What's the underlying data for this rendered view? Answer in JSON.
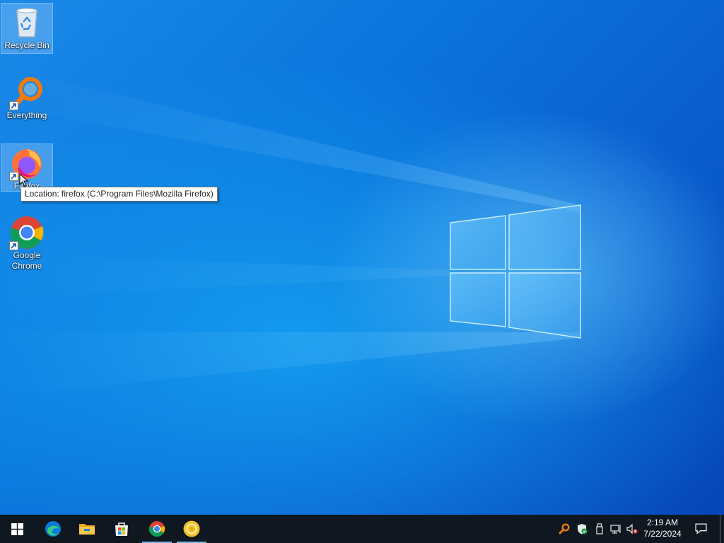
{
  "desktop": {
    "icons": [
      {
        "label": "Recycle Bin",
        "icon": "recycle-bin-icon"
      },
      {
        "label": "Everything",
        "icon": "everything-search-icon"
      },
      {
        "label": "Firefox",
        "icon": "firefox-icon"
      },
      {
        "label": "Google Chrome",
        "icon": "chrome-icon"
      }
    ]
  },
  "tooltip": {
    "text": "Location: firefox (C:\\Program Files\\Mozilla Firefox)"
  },
  "taskbar": {
    "start": {
      "icon": "windows-start-icon"
    },
    "pinned": [
      {
        "name": "Microsoft Edge",
        "icon": "edge-icon",
        "running": false
      },
      {
        "name": "File Explorer",
        "icon": "file-explorer-icon",
        "running": false
      },
      {
        "name": "Microsoft Store",
        "icon": "store-icon",
        "running": false
      },
      {
        "name": "Google Chrome",
        "icon": "chrome-icon",
        "running": true
      },
      {
        "name": "App",
        "icon": "yellow-app-icon",
        "running": true
      }
    ],
    "tray": {
      "icons": [
        "everything-tray-icon",
        "security-shield-icon",
        "usb-drive-icon",
        "network-icon",
        "volume-muted-icon"
      ],
      "time": "2:19 AM",
      "date": "7/22/2024"
    },
    "notification": {
      "icon": "action-center-icon"
    }
  }
}
